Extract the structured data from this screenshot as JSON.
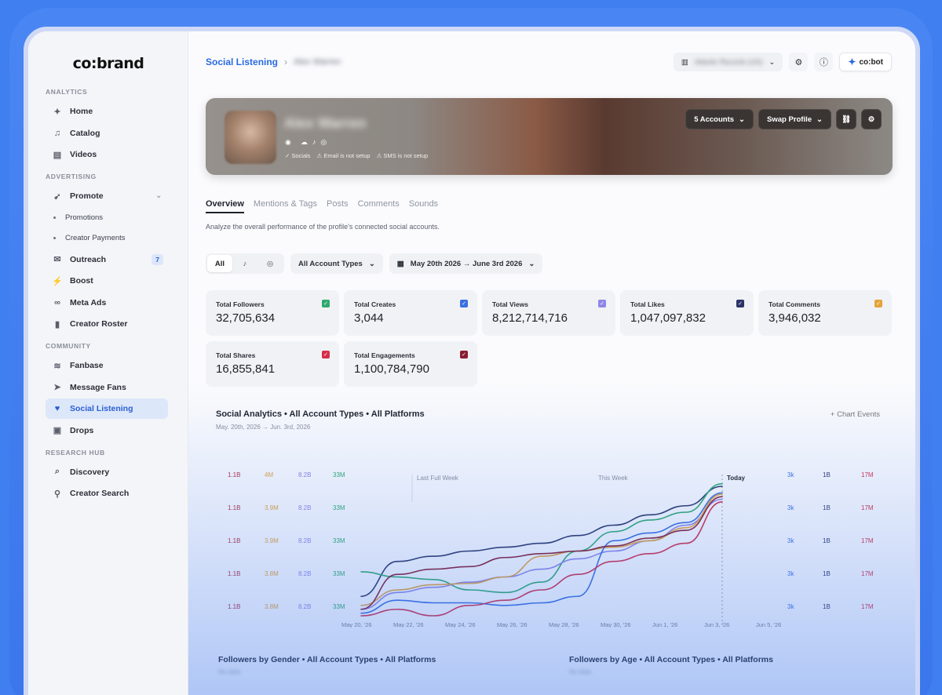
{
  "brand": {
    "logo": "co:brand"
  },
  "sidebar": {
    "sections": [
      {
        "label": "ANALYTICS"
      },
      {
        "label": "ADVERTISING"
      },
      {
        "label": "COMMUNITY"
      },
      {
        "label": "RESEARCH HUB"
      }
    ],
    "items": {
      "home": "Home",
      "catalog": "Catalog",
      "videos": "Videos",
      "promote": "Promote",
      "promotions": "Promotions",
      "creator_payments": "Creator Payments",
      "outreach": "Outreach",
      "outreach_badge": "7",
      "boost": "Boost",
      "meta_ads": "Meta Ads",
      "creator_roster": "Creator Roster",
      "fanbase": "Fanbase",
      "message_fans": "Message Fans",
      "social_listening": "Social Listening",
      "drops": "Drops",
      "discovery": "Discovery",
      "creator_search": "Creator Search"
    }
  },
  "topbar": {
    "breadcrumb_root": "Social Listening",
    "breadcrumb_current": "Alex Warren",
    "org_name": "Atlantic Records (US)",
    "cobot_label": "co:bot"
  },
  "profile": {
    "name": "Alex Warren",
    "status_socials": "✓ Socials",
    "status_email": "⚠ Email is not setup",
    "status_sms": "⚠ SMS is not setup",
    "accounts_button": "5 Accounts",
    "swap_button": "Swap Profile"
  },
  "tabs": [
    "Overview",
    "Mentions & Tags",
    "Posts",
    "Comments",
    "Sounds"
  ],
  "overview_description": "Analyze the overall performance of the profile's connected social accounts.",
  "filters": {
    "platform_all": "All",
    "account_types": "All Account Types",
    "date_range": "May 20th 2026 → June 3rd 2026"
  },
  "stats": [
    {
      "label": "Total Followers",
      "value": "32,705,634",
      "color": "#2faa6e"
    },
    {
      "label": "Total Creates",
      "value": "3,044",
      "color": "#3a6fe0"
    },
    {
      "label": "Total Views",
      "value": "8,212,714,716",
      "color": "#8e86e8"
    },
    {
      "label": "Total Likes",
      "value": "1,047,097,832",
      "color": "#2c3566"
    },
    {
      "label": "Total Comments",
      "value": "3,946,032",
      "color": "#e3a43c"
    },
    {
      "label": "Total Shares",
      "value": "16,855,841",
      "color": "#d62e4a"
    },
    {
      "label": "Total Engagements",
      "value": "1,100,784,790",
      "color": "#8a1d33"
    }
  ],
  "chart_section": {
    "title": "Social Analytics • All Account Types • All Platforms",
    "subtitle": "May. 20th, 2026 → Jun. 3rd, 2026",
    "events_button": "Chart Events"
  },
  "chart_data": {
    "type": "line",
    "x": [
      "May 20, '26",
      "May 22, '26",
      "May 24, '26",
      "May 26, '26",
      "May 28, '26",
      "May 30, '26",
      "Jun 1, '26",
      "Jun 3, '26",
      "Jun 5, '26"
    ],
    "period_markers": [
      "Last Full Week",
      "This Week",
      "Today"
    ],
    "left_axes": [
      {
        "color": "#b23048",
        "ticks": [
          "1.1B",
          "1.1B",
          "1.1B",
          "1.1B",
          "1.1B"
        ]
      },
      {
        "color": "#e3a43c",
        "ticks": [
          "4M",
          "3.9M",
          "3.9M",
          "3.8M",
          "3.8M"
        ]
      },
      {
        "color": "#8e86e8",
        "ticks": [
          "8.2B",
          "8.2B",
          "8.2B",
          "8.2B",
          "8.2B"
        ]
      },
      {
        "color": "#2faa6e",
        "ticks": [
          "33M",
          "33M",
          "33M",
          "33M",
          "33M"
        ]
      }
    ],
    "right_axes": [
      {
        "color": "#3a6fe0",
        "ticks": [
          "3k",
          "3k",
          "3k",
          "3k",
          "3k"
        ]
      },
      {
        "color": "#2c3566",
        "ticks": [
          "1B",
          "1B",
          "1B",
          "1B",
          "1B"
        ]
      },
      {
        "color": "#d62e4a",
        "ticks": [
          "17M",
          "17M",
          "17M",
          "17M",
          "17M"
        ]
      }
    ],
    "series": [
      {
        "color": "#2c3566",
        "values": [
          0.15,
          0.42,
          0.46,
          0.5,
          0.53,
          0.56,
          0.62,
          0.7,
          0.78,
          0.85,
          1.0
        ]
      },
      {
        "color": "#2faa6e",
        "values": [
          0.34,
          0.3,
          0.28,
          0.2,
          0.18,
          0.26,
          0.5,
          0.65,
          0.74,
          0.8,
          1.02
        ]
      },
      {
        "color": "#8e86e8",
        "values": [
          0.05,
          0.18,
          0.22,
          0.26,
          0.3,
          0.36,
          0.44,
          0.5,
          0.58,
          0.7,
          0.9
        ]
      },
      {
        "color": "#e3a43c",
        "values": [
          0.08,
          0.2,
          0.24,
          0.25,
          0.3,
          0.46,
          0.5,
          0.53,
          0.58,
          0.68,
          0.94
        ]
      },
      {
        "color": "#3a6fe0",
        "values": [
          0.02,
          0.12,
          0.1,
          0.1,
          0.08,
          0.1,
          0.15,
          0.58,
          0.64,
          0.72,
          0.95
        ]
      },
      {
        "color": "#d62e4a",
        "values": [
          0.0,
          0.05,
          0.0,
          0.08,
          0.12,
          0.2,
          0.32,
          0.42,
          0.48,
          0.56,
          0.88
        ]
      },
      {
        "color": "#8a1d33",
        "values": [
          0.05,
          0.32,
          0.36,
          0.38,
          0.45,
          0.48,
          0.5,
          0.54,
          0.6,
          0.66,
          0.92
        ]
      }
    ]
  },
  "bottom_charts": [
    {
      "title": "Followers by Gender • All Account Types • All Platforms",
      "subtitle": "No data"
    },
    {
      "title": "Followers by Age • All Account Types • All Platforms",
      "subtitle": "No data"
    }
  ]
}
